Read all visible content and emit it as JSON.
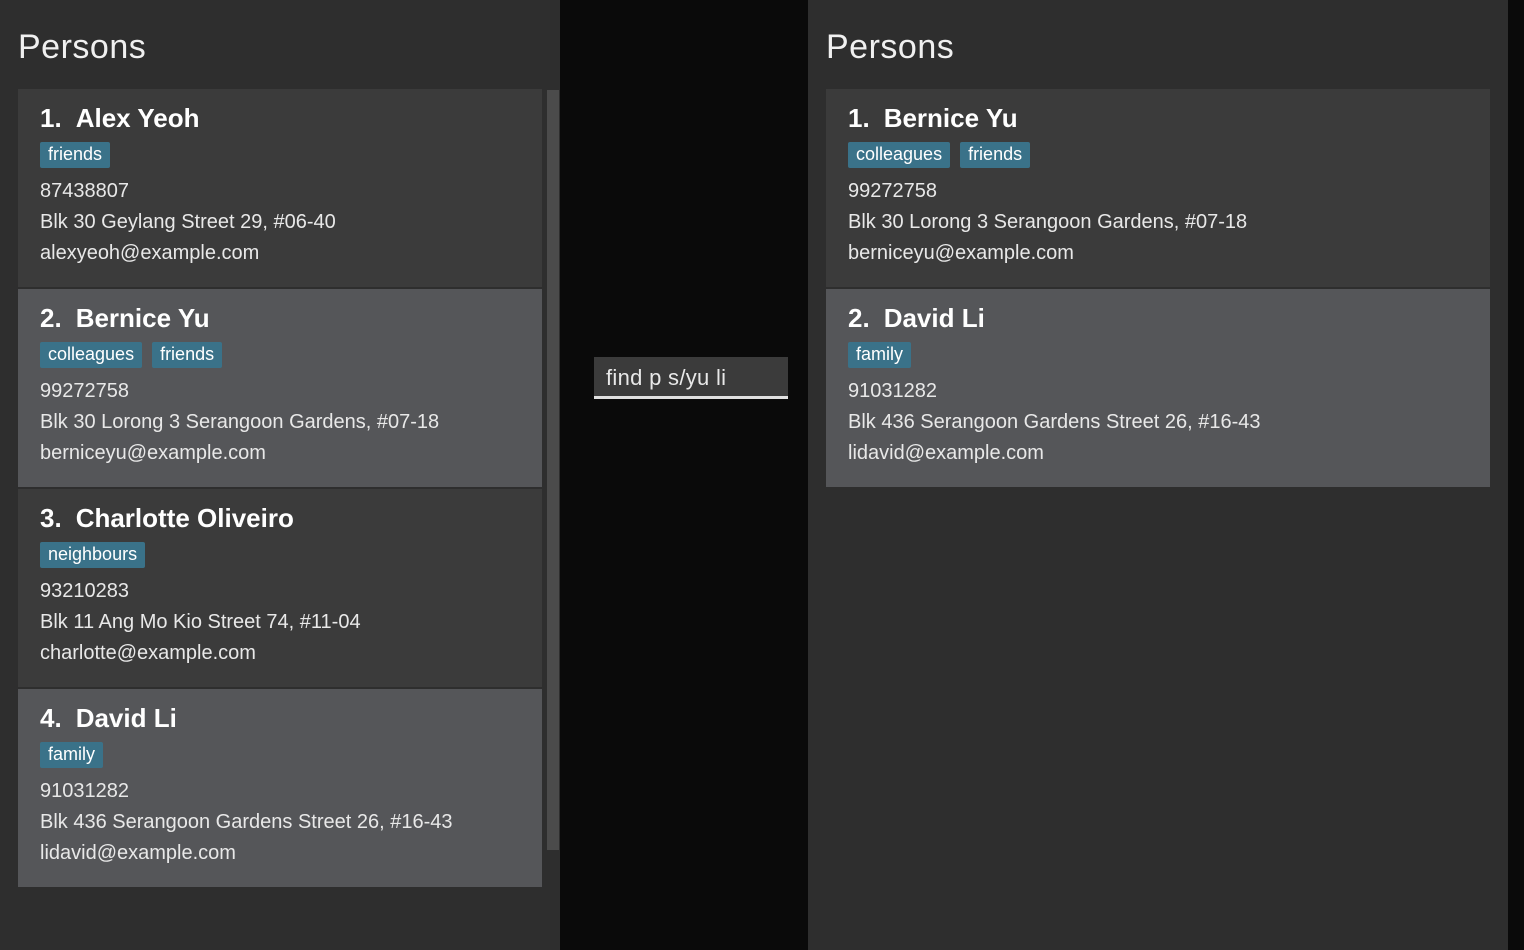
{
  "left_panel": {
    "title": "Persons",
    "persons": [
      {
        "index": "1.",
        "name": "Alex Yeoh",
        "tags": [
          "friends"
        ],
        "phone": "87438807",
        "address": "Blk 30 Geylang Street 29, #06-40",
        "email": "alexyeoh@example.com",
        "shade": "dark"
      },
      {
        "index": "2.",
        "name": "Bernice Yu",
        "tags": [
          "colleagues",
          "friends"
        ],
        "phone": "99272758",
        "address": "Blk 30 Lorong 3 Serangoon Gardens, #07-18",
        "email": "berniceyu@example.com",
        "shade": "light"
      },
      {
        "index": "3.",
        "name": "Charlotte Oliveiro",
        "tags": [
          "neighbours"
        ],
        "phone": "93210283",
        "address": "Blk 11 Ang Mo Kio Street 74, #11-04",
        "email": "charlotte@example.com",
        "shade": "dark"
      },
      {
        "index": "4.",
        "name": "David Li",
        "tags": [
          "family"
        ],
        "phone": "91031282",
        "address": "Blk 436 Serangoon Gardens Street 26, #16-43",
        "email": "lidavid@example.com",
        "shade": "light"
      }
    ]
  },
  "right_panel": {
    "title": "Persons",
    "persons": [
      {
        "index": "1.",
        "name": "Bernice Yu",
        "tags": [
          "colleagues",
          "friends"
        ],
        "phone": "99272758",
        "address": "Blk 30 Lorong 3 Serangoon Gardens, #07-18",
        "email": "berniceyu@example.com",
        "shade": "dark"
      },
      {
        "index": "2.",
        "name": "David Li",
        "tags": [
          "family"
        ],
        "phone": "91031282",
        "address": "Blk 436 Serangoon Gardens Street 26, #16-43",
        "email": "lidavid@example.com",
        "shade": "light"
      }
    ]
  },
  "command": {
    "text": "find p s/yu li"
  }
}
